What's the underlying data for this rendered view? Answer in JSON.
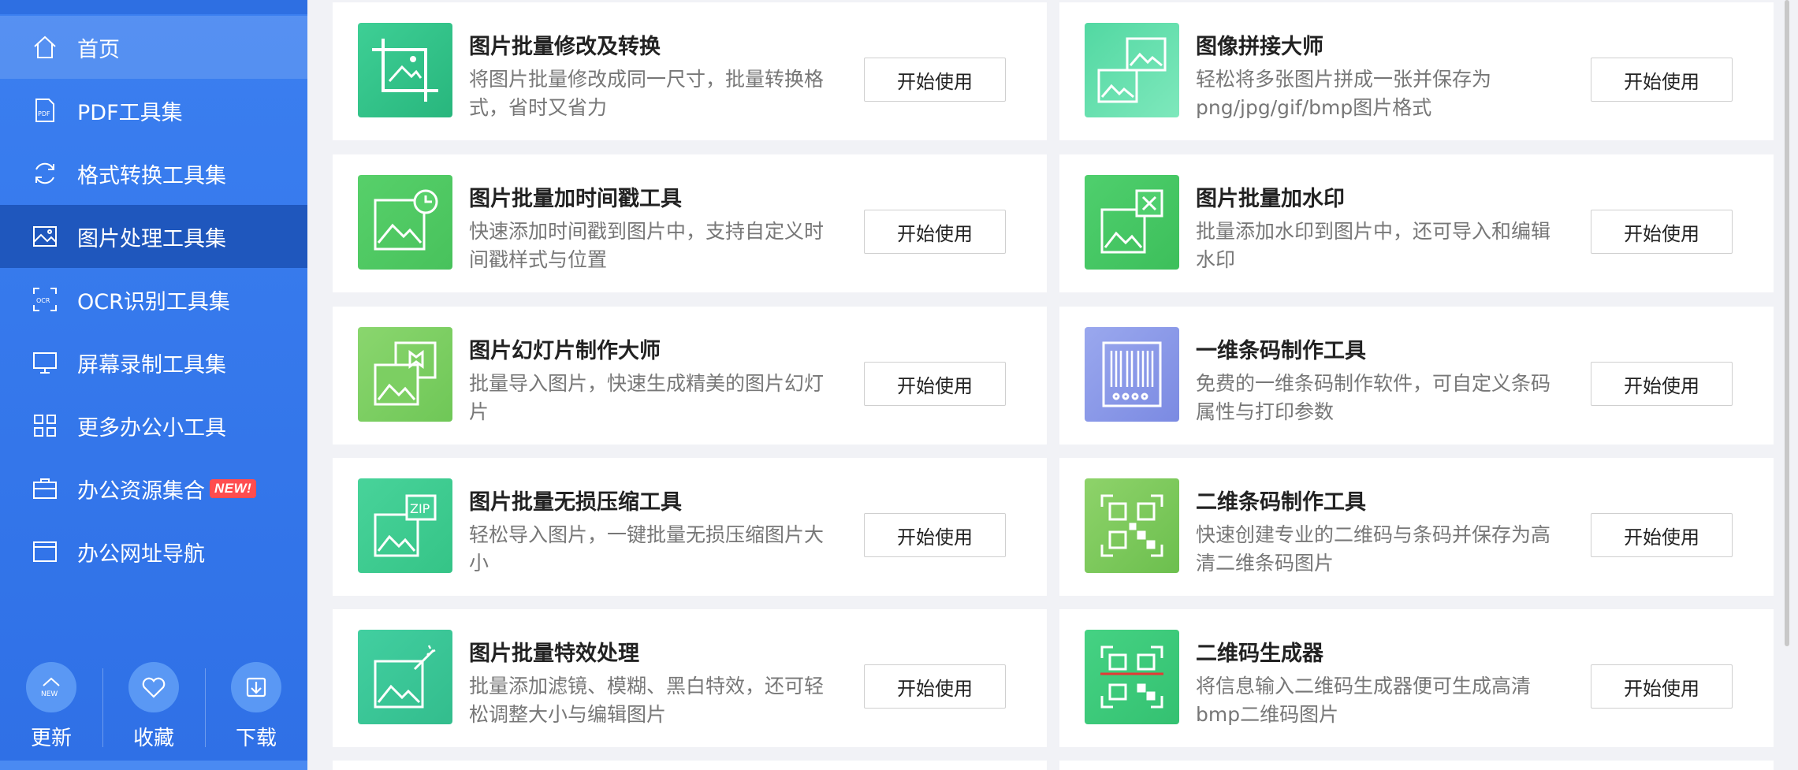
{
  "sidebar": {
    "items": [
      {
        "label": "首页",
        "icon": "home-icon"
      },
      {
        "label": "PDF工具集",
        "icon": "pdf-icon"
      },
      {
        "label": "格式转换工具集",
        "icon": "convert-icon"
      },
      {
        "label": "图片处理工具集",
        "icon": "image-icon"
      },
      {
        "label": "OCR识别工具集",
        "icon": "ocr-icon"
      },
      {
        "label": "屏幕录制工具集",
        "icon": "monitor-icon"
      },
      {
        "label": "更多办公小工具",
        "icon": "apps-icon"
      },
      {
        "label": "办公资源集合",
        "icon": "briefcase-icon",
        "badge": "NEW!"
      },
      {
        "label": "办公网址导航",
        "icon": "browser-icon"
      }
    ],
    "bottom": [
      {
        "label": "更新",
        "icon_text": "NEW"
      },
      {
        "label": "收藏"
      },
      {
        "label": "下载"
      }
    ]
  },
  "colors": {
    "sidebar_bg": "#3b7ff0",
    "sidebar_active": "#1f57bd",
    "badge": "#ff4d4f"
  },
  "tools": [
    {
      "title": "图片批量修改及转换",
      "desc": "将图片批量修改成同一尺寸，批量转换格式，省时又省力",
      "button": "开始使用",
      "icon": "crop-image-icon"
    },
    {
      "title": "图像拼接大师",
      "desc": "轻松将多张图片拼成一张并保存为png/jpg/gif/bmp图片格式",
      "button": "开始使用",
      "icon": "image-stitch-icon"
    },
    {
      "title": "图片批量加时间戳工具",
      "desc": "快速添加时间戳到图片中，支持自定义时间戳样式与位置",
      "button": "开始使用",
      "icon": "image-clock-icon"
    },
    {
      "title": "图片批量加水印",
      "desc": "批量添加水印到图片中，还可导入和编辑水印",
      "button": "开始使用",
      "icon": "image-watermark-icon"
    },
    {
      "title": "图片幻灯片制作大师",
      "desc": "批量导入图片，快速生成精美的图片幻灯片",
      "button": "开始使用",
      "icon": "image-slideshow-icon"
    },
    {
      "title": "一维条码制作工具",
      "desc": "免费的一维条码制作软件，可自定义条码属性与打印参数",
      "button": "开始使用",
      "icon": "barcode-icon"
    },
    {
      "title": "图片批量无损压缩工具",
      "desc": "轻松导入图片，一键批量无损压缩图片大小",
      "button": "开始使用",
      "icon": "image-zip-icon"
    },
    {
      "title": "二维条码制作工具",
      "desc": "快速创建专业的二维码与条码并保存为高清二维条码图片",
      "button": "开始使用",
      "icon": "qrcode-maker-icon"
    },
    {
      "title": "图片批量特效处理",
      "desc": "批量添加滤镜、模糊、黑白特效，还可轻松调整大小与编辑图片",
      "button": "开始使用",
      "icon": "image-effects-icon"
    },
    {
      "title": "二维码生成器",
      "desc": "将信息输入二维码生成器便可生成高清bmp二维码图片",
      "button": "开始使用",
      "icon": "qrcode-generator-icon"
    }
  ]
}
